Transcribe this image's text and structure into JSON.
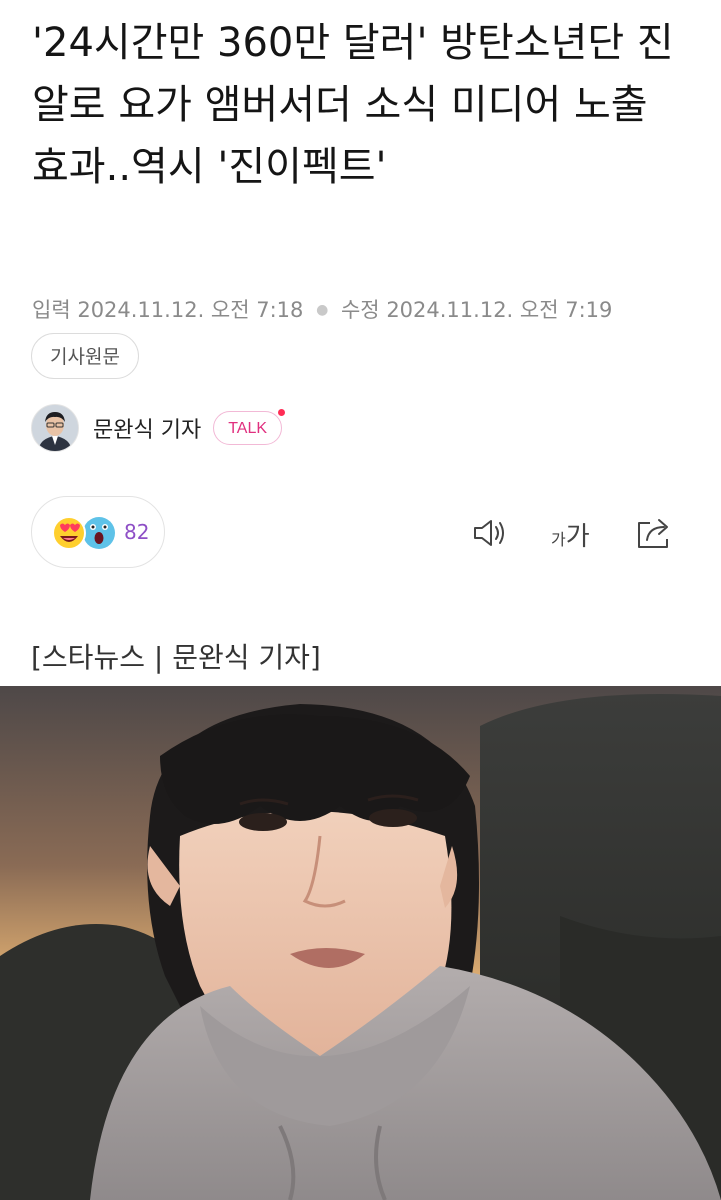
{
  "article": {
    "headline": "'24시간만 360만 달러' 방탄소년단 진 알로 요가 앰버서더 소식 미디어 노출 효과..역시 '진이펙트'",
    "input_label": "입력",
    "input_time": "2024.11.12. 오전 7:18",
    "modified_label": "수정",
    "modified_time": "2024.11.12. 오전 7:19",
    "original_button": "기사원문",
    "reporter_name": "문완식 기자",
    "talk_label": "TALK",
    "reaction_count": "82",
    "font_size_label_small": "가",
    "font_size_label_large": "가",
    "byline": "[스타뉴스 | 문완식 기자]"
  },
  "icons": {
    "reaction_love": "heart-eyes-emoji-icon",
    "reaction_surprised": "surprised-emoji-icon",
    "listen": "speaker-icon",
    "share": "share-icon"
  },
  "colors": {
    "accent_pink": "#e0307f",
    "reaction_count": "#8e4fc6",
    "meta_gray": "#8a8a8a"
  }
}
